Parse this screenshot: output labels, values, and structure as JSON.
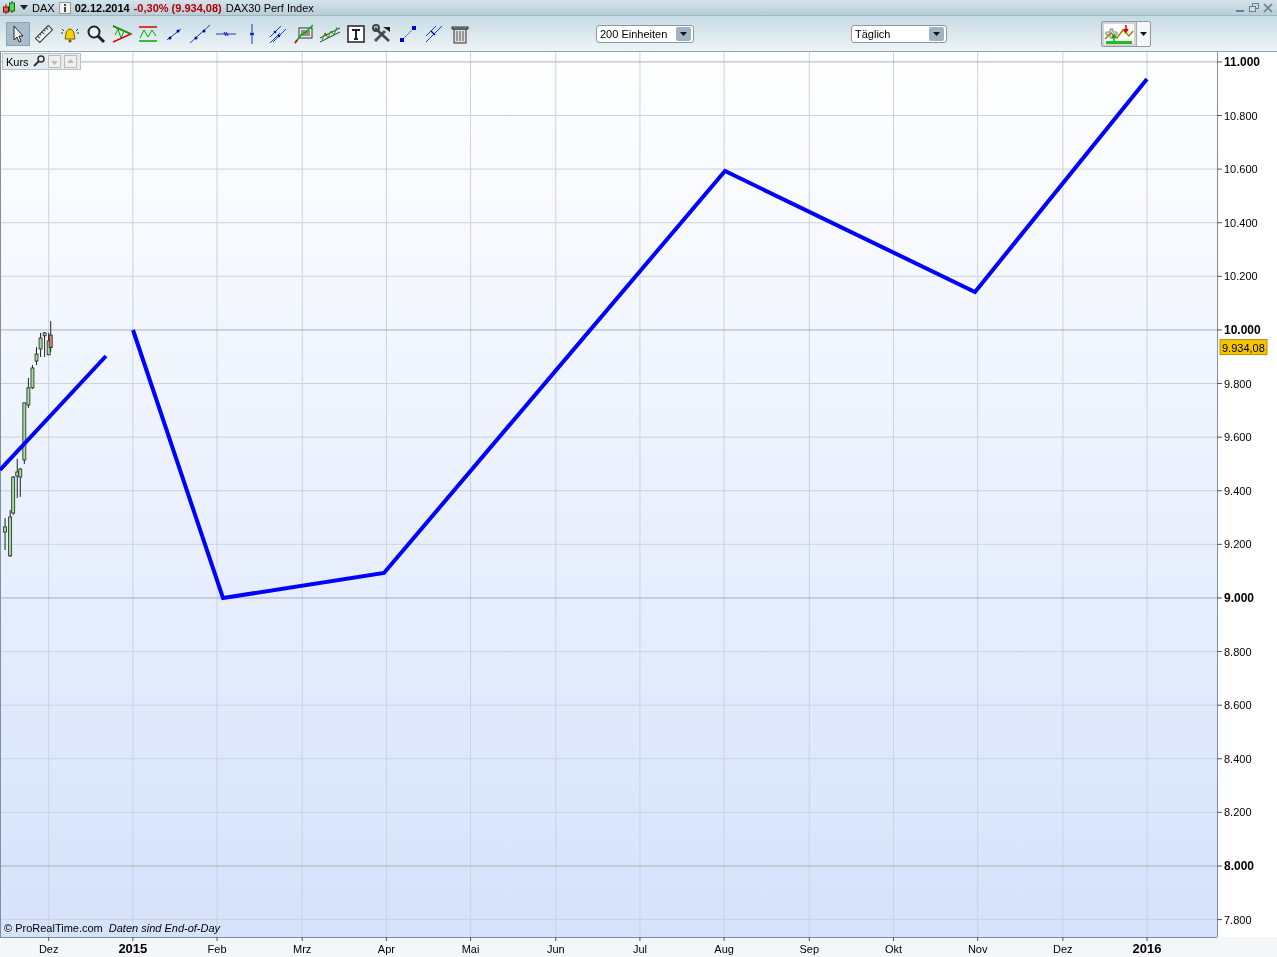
{
  "window": {
    "symbol": "DAX",
    "date": "02.12.2014",
    "change": "-0,30% (9.934,08)",
    "instrument": "DAX30 Perf Index"
  },
  "toolbar": {
    "tools": [
      {
        "selected": true
      },
      {
        "selected": false
      },
      {
        "selected": false
      },
      {
        "selected": false
      },
      {
        "selected": false
      },
      {
        "selected": false
      },
      {
        "selected": false
      },
      {
        "selected": false
      },
      {
        "selected": false
      },
      {
        "selected": false
      },
      {
        "selected": false
      },
      {
        "selected": false
      },
      {
        "selected": false
      },
      {
        "selected": false
      },
      {
        "selected": false
      },
      {
        "selected": false
      },
      {
        "selected": false
      },
      {
        "selected": false
      }
    ],
    "units_dropdown": {
      "value": "200 Einheiten"
    },
    "interval_dropdown": {
      "value": "Täglich"
    }
  },
  "chart": {
    "panel_label": "Kurs",
    "last_price": "9.934,08",
    "copyright": "© ProRealTime.com",
    "data_note": "Daten sind End-of-Day",
    "chart_data": {
      "type": "candlestick",
      "x": [
        2014.874,
        2014.879,
        2014.882,
        2014.886,
        2014.889,
        2014.893,
        2014.897,
        2014.901,
        2014.905,
        2014.909,
        2014.913,
        2014.917,
        2014.919
      ],
      "ohlc": [
        [
          9246,
          9298,
          9179,
          9265
        ],
        [
          9157,
          9328,
          9153,
          9302
        ],
        [
          9317,
          9455,
          9310,
          9451
        ],
        [
          9455,
          9519,
          9373,
          9470
        ],
        [
          9451,
          9485,
          9377,
          9481
        ],
        [
          9515,
          9728,
          9500,
          9728
        ],
        [
          9720,
          9821,
          9709,
          9784
        ],
        [
          9784,
          9869,
          9780,
          9858
        ],
        [
          9884,
          9936,
          9869,
          9910
        ],
        [
          9929,
          9989,
          9899,
          9970
        ],
        [
          9978,
          9992,
          9899,
          9989
        ],
        [
          9907,
          9989,
          9907,
          9959
        ],
        [
          9981,
          10033,
          9918,
          9934.08
        ]
      ],
      "grid": true,
      "xlim": [
        2014.869,
        2016.069
      ],
      "ylim": [
        7735,
        11037
      ],
      "xticks": [
        {
          "value": 2014.917,
          "label": "Dez"
        },
        {
          "value": 2015,
          "label": "2015"
        },
        {
          "value": 2015.083,
          "label": "Feb"
        },
        {
          "value": 2015.167,
          "label": "Mrz"
        },
        {
          "value": 2015.25,
          "label": "Apr"
        },
        {
          "value": 2015.333,
          "label": "Mai"
        },
        {
          "value": 2015.417,
          "label": "Jun"
        },
        {
          "value": 2015.5,
          "label": "Jul"
        },
        {
          "value": 2015.583,
          "label": "Aug"
        },
        {
          "value": 2015.667,
          "label": "Sep"
        },
        {
          "value": 2015.75,
          "label": "Okt"
        },
        {
          "value": 2015.833,
          "label": "Nov"
        },
        {
          "value": 2015.917,
          "label": "Dez"
        },
        {
          "value": 2016,
          "label": "2016"
        }
      ],
      "yticks": [
        {
          "value": 7800,
          "label": "7.800"
        },
        {
          "value": 8000,
          "label": "8.000"
        },
        {
          "value": 8200,
          "label": "8.200"
        },
        {
          "value": 8400,
          "label": "8.400"
        },
        {
          "value": 8600,
          "label": "8.600"
        },
        {
          "value": 8800,
          "label": "8.800"
        },
        {
          "value": 9000,
          "label": "9.000"
        },
        {
          "value": 9200,
          "label": "9.200"
        },
        {
          "value": 9400,
          "label": "9.400"
        },
        {
          "value": 9600,
          "label": "9.600"
        },
        {
          "value": 9800,
          "label": "9.800"
        },
        {
          "value": 10000,
          "label": "10.000"
        },
        {
          "value": 10200,
          "label": "10.200"
        },
        {
          "value": 10400,
          "label": "10.400"
        },
        {
          "value": 10600,
          "label": "10.600"
        },
        {
          "value": 10800,
          "label": "10.800"
        },
        {
          "value": 11000,
          "label": "11.000"
        }
      ]
    }
  }
}
